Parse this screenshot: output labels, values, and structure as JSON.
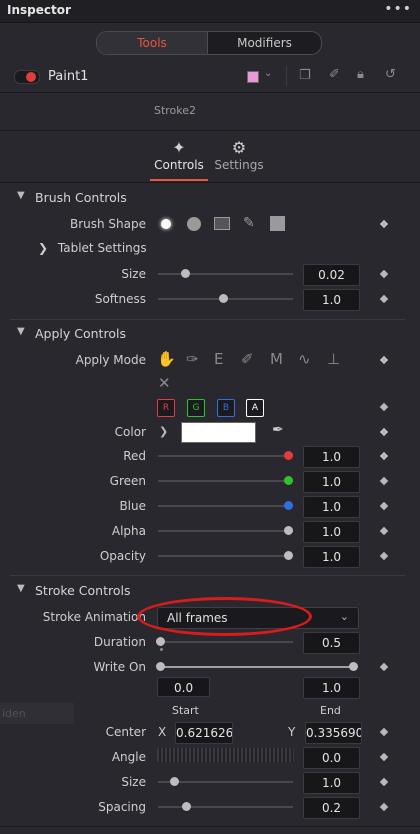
{
  "header": {
    "title": "Inspector",
    "menu": "•••"
  },
  "tabs_top": {
    "tools": "Tools",
    "modifiers": "Modifiers"
  },
  "node": {
    "name": "Paint1",
    "stroke_label": "Stroke2"
  },
  "subtabs": {
    "controls": "Controls",
    "settings": "Settings"
  },
  "brush": {
    "header": "Brush Controls",
    "shape_label": "Brush Shape",
    "tablet": "Tablet Settings",
    "size_label": "Size",
    "size_value": "0.02",
    "softness_label": "Softness",
    "softness_value": "1.0"
  },
  "apply": {
    "header": "Apply Controls",
    "mode_label": "Apply Mode",
    "channels": [
      "R",
      "G",
      "B",
      "A"
    ],
    "color_label": "Color",
    "red_label": "Red",
    "red_value": "1.0",
    "green_label": "Green",
    "green_value": "1.0",
    "blue_label": "Blue",
    "blue_value": "1.0",
    "alpha_label": "Alpha",
    "alpha_value": "1.0",
    "opacity_label": "Opacity",
    "opacity_value": "1.0"
  },
  "stroke": {
    "header": "Stroke Controls",
    "animation_label": "Stroke Animation",
    "animation_value": "All frames",
    "duration_label": "Duration",
    "duration_value": "0.5",
    "writeon_label": "Write On",
    "start_value": "0.0",
    "end_value": "1.0",
    "start_label": "Start",
    "end_label": "End",
    "center_label": "Center",
    "center_x_label": "X",
    "center_x": "0.621626",
    "center_y_label": "Y",
    "center_y": "0.335690",
    "angle_label": "Angle",
    "angle_value": "0.0",
    "size_label": "Size",
    "size_value": "1.0",
    "spacing_label": "Spacing",
    "spacing_value": "0.2"
  },
  "side_panel_text": "iden",
  "colors": {
    "accent": "#e8553e",
    "red": "#e23c3c",
    "green": "#2fc22f",
    "blue": "#2f6fe0"
  }
}
